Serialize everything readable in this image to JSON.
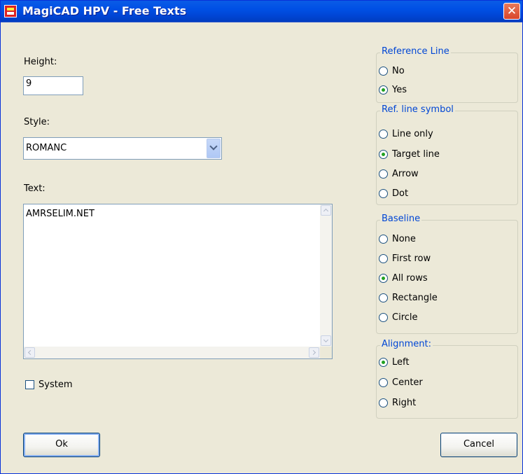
{
  "window": {
    "title": "MagiCAD HPV - Free Texts",
    "close_glyph": "✕"
  },
  "height": {
    "label": "Height:",
    "value": "9"
  },
  "style": {
    "label": "Style:",
    "value": "ROMANC"
  },
  "text": {
    "label": "Text:",
    "value": "AMRSELIM.NET"
  },
  "system": {
    "label": "System",
    "checked": false
  },
  "groups": {
    "reference_line": {
      "title": "Reference Line",
      "options": [
        "No",
        "Yes"
      ],
      "selected": "Yes"
    },
    "ref_line_symbol": {
      "title": "Ref. line symbol",
      "options": [
        "Line only",
        "Target line",
        "Arrow",
        "Dot"
      ],
      "selected": "Target line"
    },
    "baseline": {
      "title": "Baseline",
      "options": [
        "None",
        "First row",
        "All rows",
        "Rectangle",
        "Circle"
      ],
      "selected": "All rows"
    },
    "alignment": {
      "title": "Alignment:",
      "options": [
        "Left",
        "Center",
        "Right"
      ],
      "selected": "Left"
    }
  },
  "buttons": {
    "ok": "Ok",
    "cancel": "Cancel"
  },
  "colors": {
    "titlebar": "#0054e3",
    "group_title": "#0046d5",
    "dialog_bg": "#ece9d8",
    "radio_dot": "#21a121"
  }
}
